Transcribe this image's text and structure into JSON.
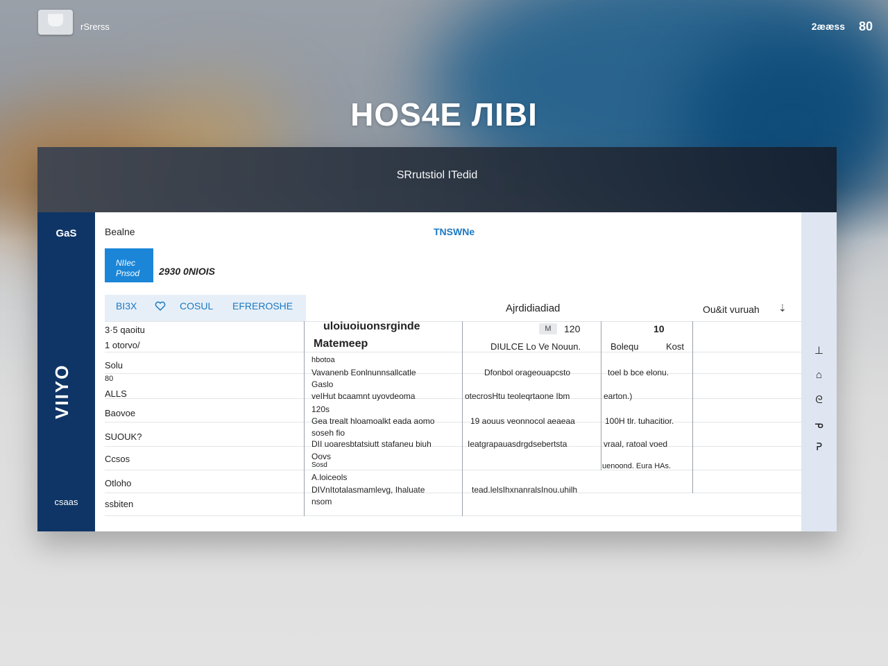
{
  "topbar": {
    "brand": "rSrerss",
    "right_text": "2ææss",
    "right_icon": "80"
  },
  "hero": {
    "title": "HOS4E ЛIBI"
  },
  "panel": {
    "header": "SRrutstiol ITedid",
    "sidebar": {
      "top": "GaS",
      "vertical": "VIIYO",
      "bottom": "csaas"
    },
    "main": {
      "home_label": "Bealne",
      "tab_label": "TNSWNe",
      "new_button": [
        "NIIec",
        "Pnsod"
      ],
      "count": "2930 0NIOIS",
      "filters": [
        "BI3X",
        "COSUL",
        "EFREROSHE"
      ],
      "filter_icon": "heart-icon",
      "selection_label": "Ajrdidiadiad",
      "sort_label": "Ou&it vuruah",
      "sort_caret": "⇣",
      "row_labels": [
        "3·5 qaoitu",
        "1 otorvo/",
        "Solu",
        "80",
        "ALLS",
        "Baovoe",
        "SUOUK?",
        "Ccsos",
        "Otloho",
        "ssbiten"
      ],
      "table": {
        "head_col1": [
          "uloiuoiuonsrginde",
          "Matemeep"
        ],
        "head_col2": "DIULCE Lo Ve Nouun.",
        "head_col2_badge": "M",
        "head_col2_num": "120",
        "head_col3_num": "10",
        "head_col3": "Bolequ",
        "head_col4": "Kost",
        "col1": [
          "hbotoa",
          "Vavanenb Eonlnunnsallcatle",
          "Gaslo",
          "veIHut bcaamnt uyovdeoma",
          "120s",
          "Gea trealt hloamoalkt eada aomo",
          "soseh fio",
          "DII uoaresbtatsiutt stafaneu biuh",
          "Oovs",
          "Sosd",
          "A.loiceols",
          "DIVnItotalasmamlevg, Ihaluate",
          "nsom"
        ],
        "col2": [
          "Dfonbol orageouapcsto",
          "otecrosHtu teoleqrtaone Ibm",
          "19 aouus veonnocol aeaeaa",
          "Ieatgrapauasdrgdsebertsta",
          "tead.lelsIhxnanralsInou.uhilh"
        ],
        "col3": [
          "toel b bce elonu.",
          "earton.)",
          "100H tlr. tuhacitior.",
          "vraal, ratoal voed",
          "uenoond. Eura HAs."
        ]
      }
    },
    "rail": [
      "⊥",
      "⌂",
      "ᘓ",
      "ᓀ",
      "ᕈ"
    ]
  }
}
